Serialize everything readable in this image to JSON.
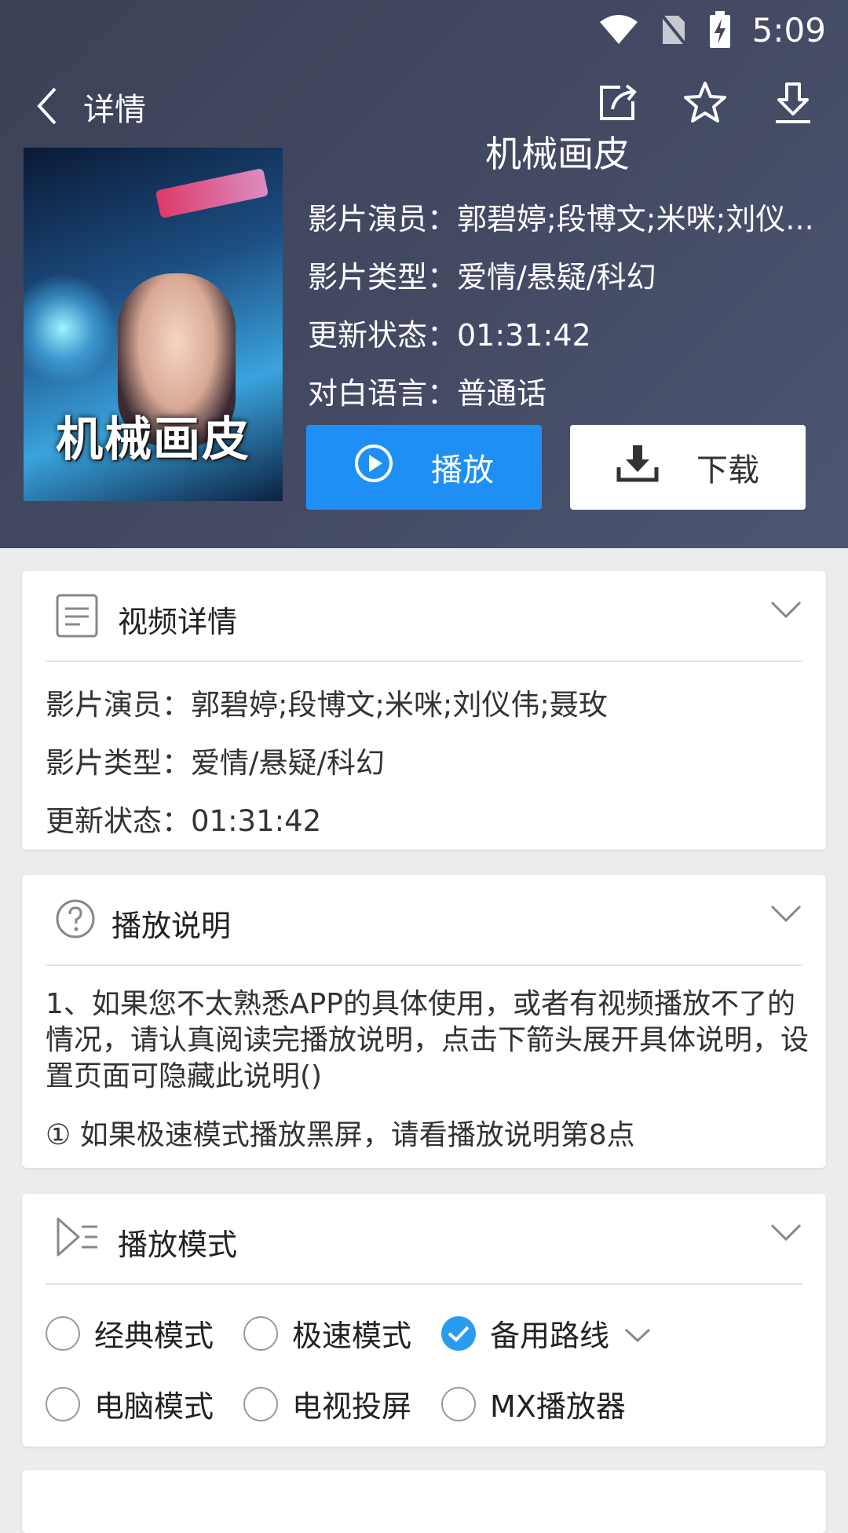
{
  "status_bar": {
    "time": "5:09"
  },
  "nav": {
    "title": "详情"
  },
  "movie": {
    "poster_text": "机械画皮",
    "title": "机械画皮",
    "actors_line": "影片演员：郭碧婷;段博文;米咪;刘仪...",
    "genre_line": "影片类型：爱情/悬疑/科幻",
    "status_line": "更新状态：01:31:42",
    "language_line": "对白语言：普通话"
  },
  "buttons": {
    "play": "播放",
    "download": "下载"
  },
  "video_details": {
    "title": "视频详情",
    "actors": "影片演员：郭碧婷;段博文;米咪;刘仪伟;聂玫",
    "genre": "影片类型：爱情/悬疑/科幻",
    "status": "更新状态：01:31:42"
  },
  "play_instructions": {
    "title": "播放说明",
    "text": "1、如果您不太熟悉APP的具体使用，或者有视频播放不了的情况，请认真阅读完播放说明，点击下箭头展开具体说明，设置页面可隐藏此说明()",
    "note": "① 如果极速模式播放黑屏，请看播放说明第8点"
  },
  "play_mode": {
    "title": "播放模式",
    "options": [
      {
        "label": "经典模式",
        "checked": false
      },
      {
        "label": "极速模式",
        "checked": false
      },
      {
        "label": "备用路线",
        "checked": true
      },
      {
        "label": "电脑模式",
        "checked": false
      },
      {
        "label": "电视投屏",
        "checked": false
      },
      {
        "label": "MX播放器",
        "checked": false
      }
    ]
  },
  "colors": {
    "accent": "#1f8ff5",
    "header_bg": "#41475e",
    "check": "#2a9cf0"
  }
}
